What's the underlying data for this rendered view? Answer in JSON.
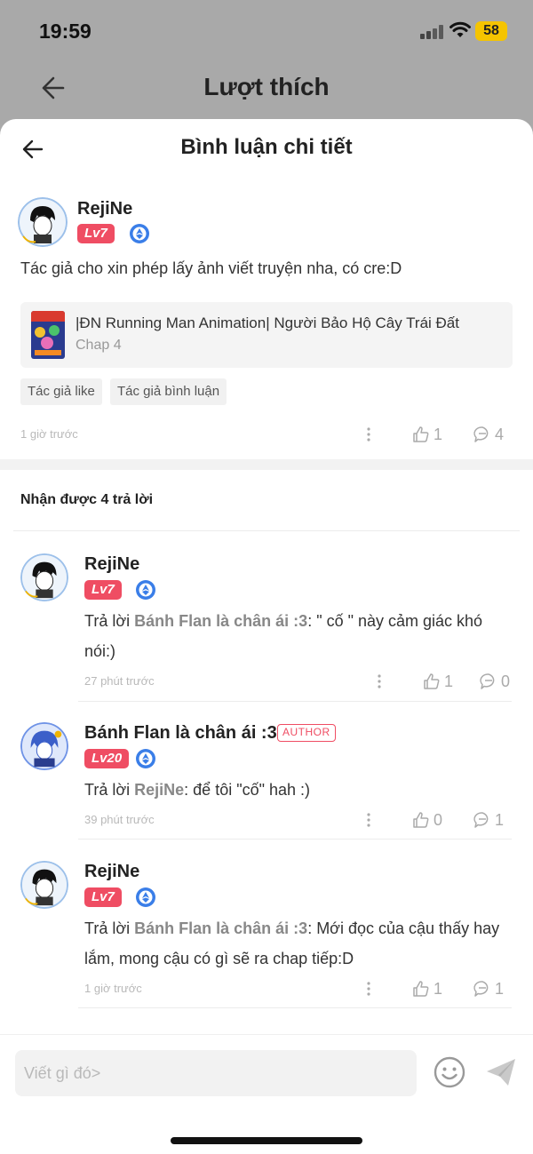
{
  "status_bar": {
    "time": "19:59",
    "battery": "58"
  },
  "background_header": {
    "title": "Lượt thích"
  },
  "sheet": {
    "title": "Bình luận chi tiết",
    "comment": {
      "username": "RejiNe",
      "level": "Lv7",
      "text": "Tác giả cho xin phép lấy ảnh viết truyện nha, có cre:D",
      "story": {
        "title": "|ĐN Running Man Animation| Người Bảo Hộ Cây Trái Đất",
        "chapter": "Chap 4"
      },
      "tags": [
        "Tác giả like",
        "Tác giả bình luận"
      ],
      "time": "1 giờ trước",
      "likes": "1",
      "replies": "4"
    },
    "replies_header": "Nhận được 4 trả lời",
    "replies": [
      {
        "username": "RejiNe",
        "level": "Lv7",
        "author_tag": "",
        "prefix": "Trả lời ",
        "mention": "Bánh Flan là chân ái :3",
        "text_line1": ": \" cố \" này cảm giác khó",
        "text_line2": "nói:)",
        "time": "27 phút trước",
        "likes": "1",
        "replies": "0"
      },
      {
        "username": "Bánh Flan là chân ái :3",
        "level": "Lv20",
        "author_tag": "AUTHOR",
        "prefix": "Trả lời ",
        "mention": "RejiNe",
        "text_line1": ": để tôi \"cố\" hah :)",
        "text_line2": "",
        "time": "39 phút trước",
        "likes": "0",
        "replies": "1"
      },
      {
        "username": "RejiNe",
        "level": "Lv7",
        "author_tag": "",
        "prefix": "Trả lời ",
        "mention": "Bánh Flan là chân ái :3",
        "text_line1": ": Mới đọc của cậu thấy hay",
        "text_line2": "lắm, mong cậu có gì sẽ ra chap tiếp:D",
        "time": "1 giờ trước",
        "likes": "1",
        "replies": "1"
      }
    ]
  },
  "composer": {
    "placeholder": "Viết gì đó>"
  },
  "colors": {
    "accent": "#ef4d63",
    "badge_blue": "#3a7ee8",
    "muted": "#aaaaaa"
  }
}
